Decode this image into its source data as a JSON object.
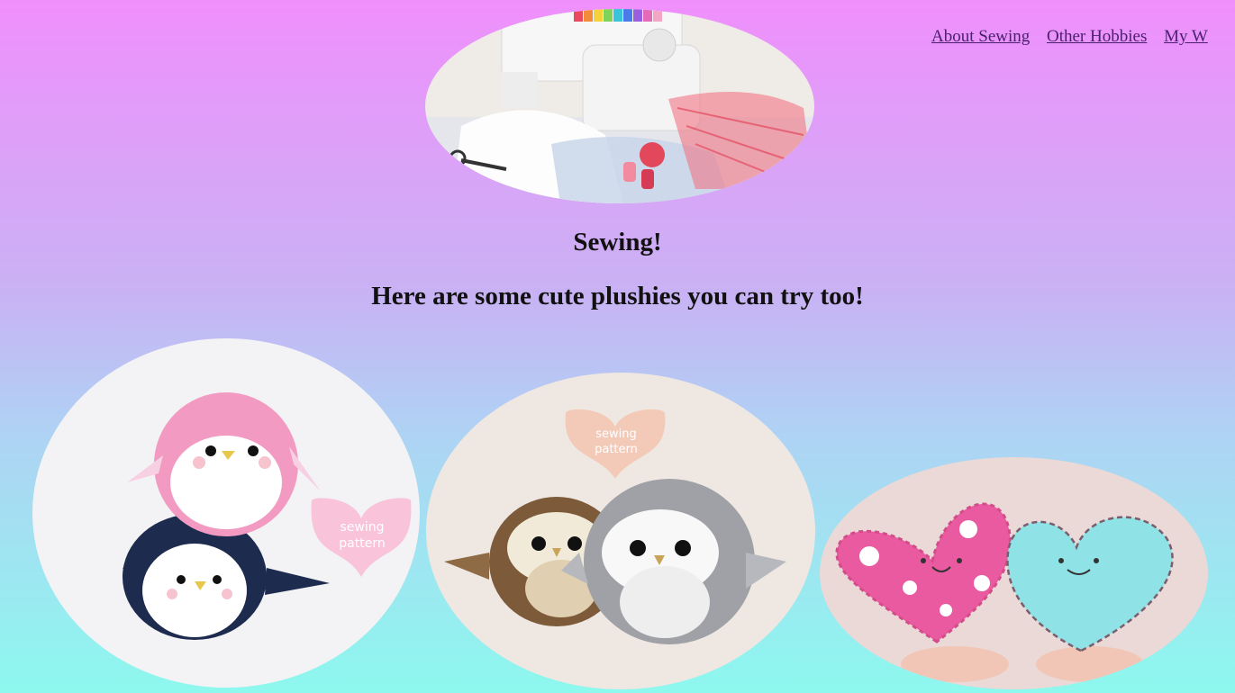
{
  "nav": {
    "links": [
      "About Sewing",
      "Other Hobbies",
      "My W"
    ]
  },
  "header": {
    "title": "Sewing!",
    "subtitle": "Here are some cute plushies you can try too!"
  },
  "images": {
    "hero": "sewing-machine-image",
    "plushie_1": "penguin-plushies-image",
    "plushie_2": "owl-plushies-image",
    "plushie_3": "heart-plushies-image"
  },
  "watermarks": {
    "line1": "sewing",
    "line2": "pattern"
  },
  "colors": {
    "gradient_top": "#f08ffc",
    "gradient_bottom": "#8df8ee",
    "link": "#4a1f6e"
  }
}
